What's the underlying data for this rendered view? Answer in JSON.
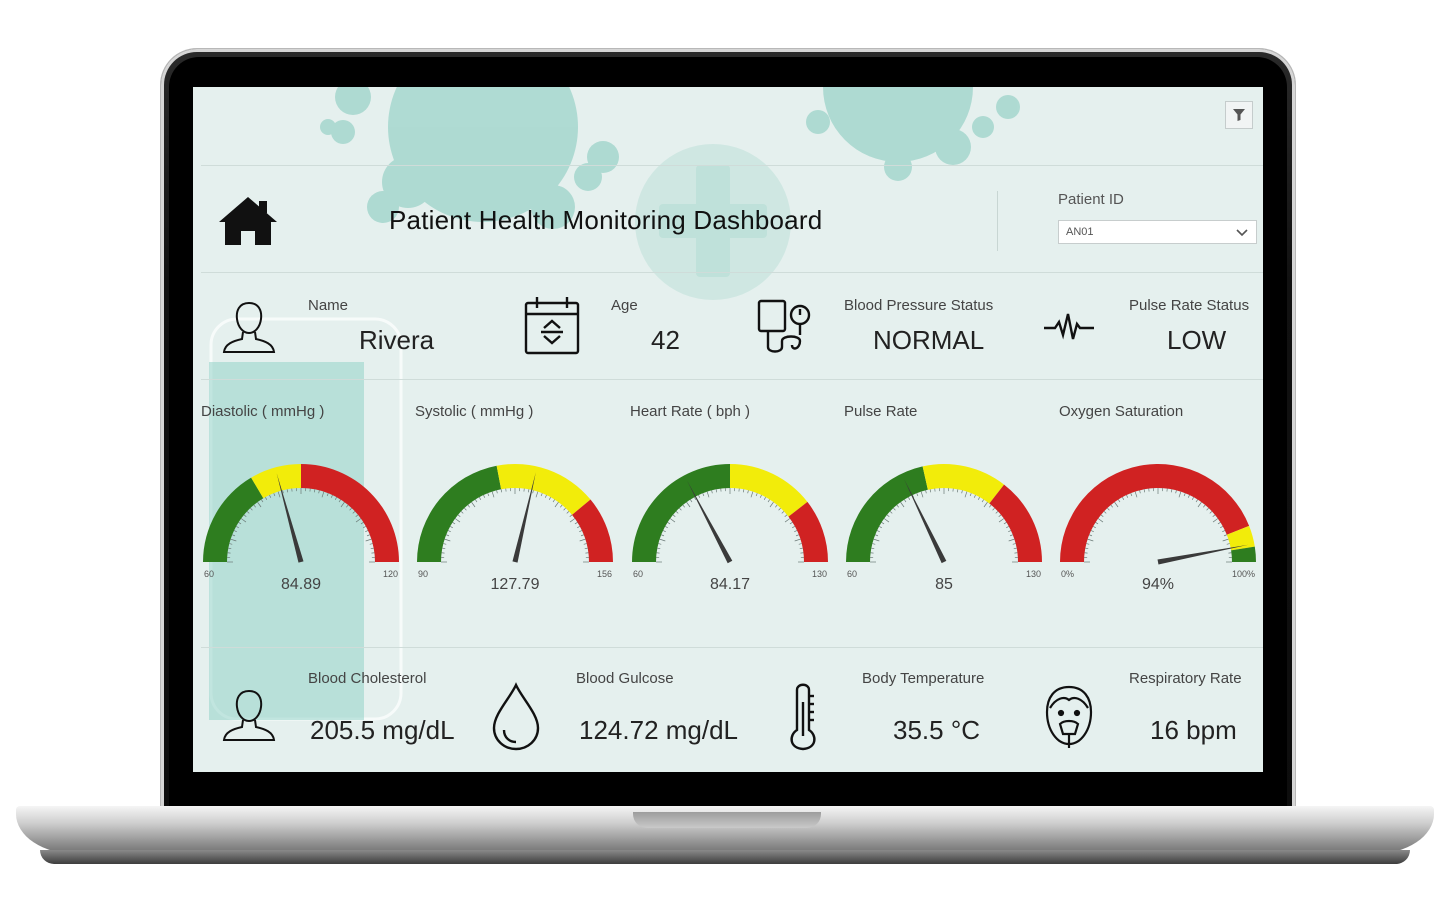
{
  "header": {
    "title": "Patient Health Monitoring Dashboard",
    "patient_id_label": "Patient ID",
    "patient_id_value": "AN01",
    "icons": {
      "home": "home-icon",
      "filter": "filter-icon",
      "dropdown": "chevron-down-icon"
    }
  },
  "info": [
    {
      "label": "Name",
      "value": "Rivera",
      "icon": "person-icon"
    },
    {
      "label": "Age",
      "value": "42",
      "icon": "calendar-icon"
    },
    {
      "label": "Blood Pressure Status",
      "value": "NORMAL",
      "icon": "blood-pressure-icon"
    },
    {
      "label": "Pulse Rate Status",
      "value": "LOW",
      "icon": "pulse-icon"
    }
  ],
  "gauges": [
    {
      "title": "Diastolic ( mmHg )",
      "value": 84.89,
      "display": "84.89",
      "min": 60,
      "max": 120,
      "min_label": "60",
      "max_label": "120",
      "bands": [
        {
          "to": 0.33,
          "color": "#2e7d1f"
        },
        {
          "to": 0.5,
          "color": "#f2ec0a"
        },
        {
          "to": 1,
          "color": "#d02222"
        }
      ]
    },
    {
      "title": "Systolic ( mmHg )",
      "value": 127.79,
      "display": "127.79",
      "min": 90,
      "max": 156,
      "min_label": "90",
      "max_label": "156",
      "bands": [
        {
          "to": 0.44,
          "color": "#2e7d1f"
        },
        {
          "to": 0.78,
          "color": "#f2ec0a"
        },
        {
          "to": 1,
          "color": "#d02222"
        }
      ]
    },
    {
      "title": "Heart Rate ( bph )",
      "value": 84.17,
      "display": "84.17",
      "min": 60,
      "max": 130,
      "min_label": "60",
      "max_label": "130",
      "bands": [
        {
          "to": 0.5,
          "color": "#2e7d1f"
        },
        {
          "to": 0.79,
          "color": "#f2ec0a"
        },
        {
          "to": 1,
          "color": "#d02222"
        }
      ]
    },
    {
      "title": "Pulse Rate",
      "value": 85,
      "display": "85",
      "min": 60,
      "max": 130,
      "min_label": "60",
      "max_label": "130",
      "bands": [
        {
          "to": 0.43,
          "color": "#2e7d1f"
        },
        {
          "to": 0.71,
          "color": "#f2ec0a"
        },
        {
          "to": 1,
          "color": "#d02222"
        }
      ]
    },
    {
      "title": "Oxygen Saturation",
      "value": 94,
      "display": "94%",
      "min": 0,
      "max": 100,
      "min_label": "0%",
      "max_label": "100%",
      "bands": [
        {
          "to": 0.88,
          "color": "#d02222"
        },
        {
          "to": 0.95,
          "color": "#f2ec0a"
        },
        {
          "to": 1,
          "color": "#2e7d1f"
        }
      ]
    }
  ],
  "metrics": [
    {
      "label": "Blood Cholesterol",
      "value": "205.5 mg/dL",
      "icon": "person-icon"
    },
    {
      "label": "Blood Gulcose",
      "value": "124.72 mg/dL",
      "icon": "blood-drop-icon"
    },
    {
      "label": "Body Temperature",
      "value": "35.5 °C",
      "icon": "thermometer-icon"
    },
    {
      "label": "Respiratory Rate",
      "value": "16 bpm",
      "icon": "oxygen-mask-icon"
    }
  ],
  "colors": {
    "background": "#e5f0ee",
    "accent": "#a9d8cf",
    "green": "#2e7d1f",
    "yellow": "#f2ec0a",
    "red": "#d02222"
  }
}
